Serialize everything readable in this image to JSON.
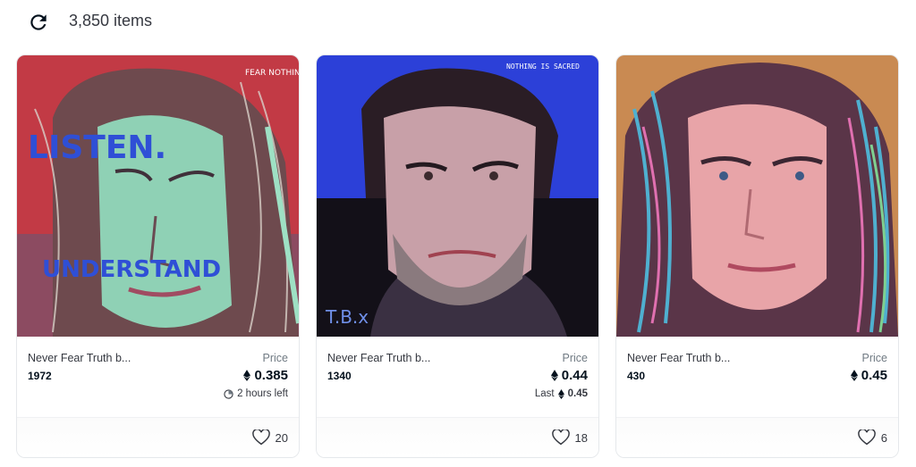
{
  "header": {
    "item_count": "3,850 items"
  },
  "cards": [
    {
      "name": "Never Fear Truth b...",
      "token_id": "1972",
      "price_label": "Price",
      "price": "0.385",
      "sub_text": "2 hours left",
      "sub_icon": "clock-icon",
      "likes": "20",
      "art_texts": {
        "a": "LISTEN.",
        "b": "UNDERSTAND",
        "c": "FEAR NOTHING FORWARD"
      }
    },
    {
      "name": "Never Fear Truth b...",
      "token_id": "1340",
      "price_label": "Price",
      "price": "0.44",
      "sub_text": "Last",
      "sub_price": "0.45",
      "likes": "18",
      "art_texts": {
        "a": "T.B.x",
        "b": "NOTHING IS SACRED",
        "c": ""
      }
    },
    {
      "name": "Never Fear Truth b...",
      "token_id": "430",
      "price_label": "Price",
      "price": "0.45",
      "likes": "6",
      "art_texts": {
        "a": "",
        "b": "",
        "c": ""
      }
    }
  ],
  "colors": {
    "accent": "#2081e2",
    "border": "#e5e8eb",
    "text": "#04111d",
    "muted": "#707a83"
  }
}
